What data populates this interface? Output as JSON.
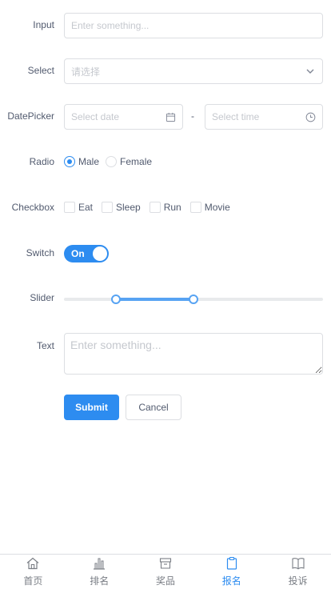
{
  "form": {
    "input": {
      "label": "Input",
      "placeholder": "Enter something..."
    },
    "select": {
      "label": "Select",
      "placeholder": "请选择"
    },
    "datepicker": {
      "label": "DatePicker",
      "date_placeholder": "Select date",
      "separator": "-",
      "time_placeholder": "Select time"
    },
    "radio": {
      "label": "Radio",
      "options": [
        "Male",
        "Female"
      ],
      "selected": "Male"
    },
    "checkbox": {
      "label": "Checkbox",
      "options": [
        "Eat",
        "Sleep",
        "Run",
        "Movie"
      ]
    },
    "switch": {
      "label": "Switch",
      "text": "On",
      "value": true
    },
    "slider": {
      "label": "Slider",
      "min": 0,
      "max": 100,
      "range": [
        20,
        50
      ]
    },
    "text": {
      "label": "Text",
      "placeholder": "Enter something..."
    },
    "buttons": {
      "submit": "Submit",
      "cancel": "Cancel"
    }
  },
  "tabbar": {
    "items": [
      {
        "label": "首页",
        "icon": "home-icon"
      },
      {
        "label": "排名",
        "icon": "bar-chart-icon"
      },
      {
        "label": "奖品",
        "icon": "archive-icon"
      },
      {
        "label": "报名",
        "icon": "clipboard-icon"
      },
      {
        "label": "投诉",
        "icon": "book-icon"
      }
    ],
    "active_index": 3
  },
  "colors": {
    "primary": "#2d8cf0",
    "border": "#dcdee2",
    "placeholder": "#c5c8ce",
    "text": "#515a6e"
  }
}
